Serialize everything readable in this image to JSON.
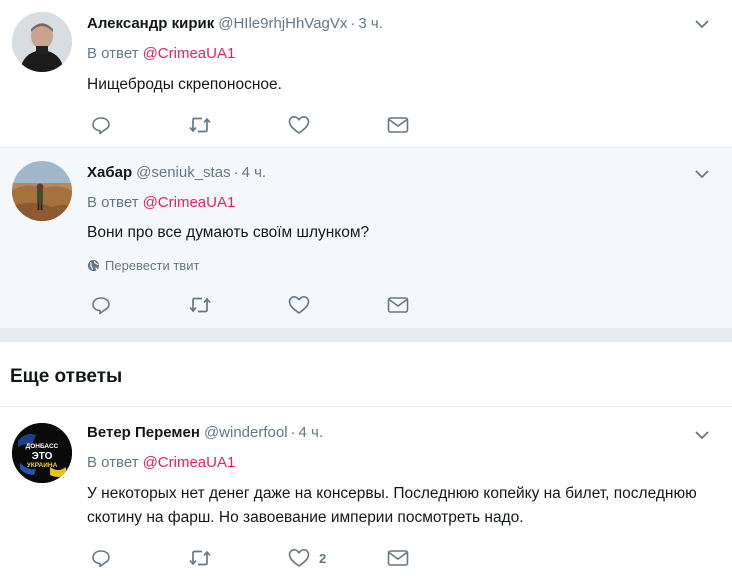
{
  "colors": {
    "accent": "#e0245e",
    "muted": "#657786",
    "bg": "#e6ecf0",
    "tinted": "#f5f8fa"
  },
  "tweets": [
    {
      "name": "Александр кирик",
      "handle": "@HIle9rhjHhVagVx",
      "dot": "·",
      "time": "3 ч.",
      "reply_label": "В ответ",
      "reply_mention": "@CrimeaUA1",
      "text": "Нищеброды скрепоносное."
    },
    {
      "name": "Хабар",
      "handle": "@seniuk_stas",
      "dot": "·",
      "time": "4 ч.",
      "reply_label": "В ответ",
      "reply_mention": "@CrimeaUA1",
      "text": "Вони про все думають своїм шлунком?",
      "translate": "Перевести твит"
    },
    {
      "name": "Ветер Перемен",
      "handle": "@winderfool",
      "dot": "·",
      "time": "4 ч.",
      "reply_label": "В ответ",
      "reply_mention": "@CrimeaUA1",
      "text": "У некоторых нет денег даже на консервы. Последнюю копейку на билет, последнюю скотину на фарш. Но завоевание империи посмотреть надо.",
      "like_count": "2",
      "avatar_text_line1": "ДОНБАСС",
      "avatar_text_line2": "ЭТО",
      "avatar_text_line3": "УКРАИНА"
    }
  ],
  "section": {
    "title": "Еще ответы"
  },
  "icons": [
    "reply-icon",
    "retweet-icon",
    "like-icon",
    "direct-message-icon",
    "chevron-down-icon",
    "globe-icon"
  ]
}
